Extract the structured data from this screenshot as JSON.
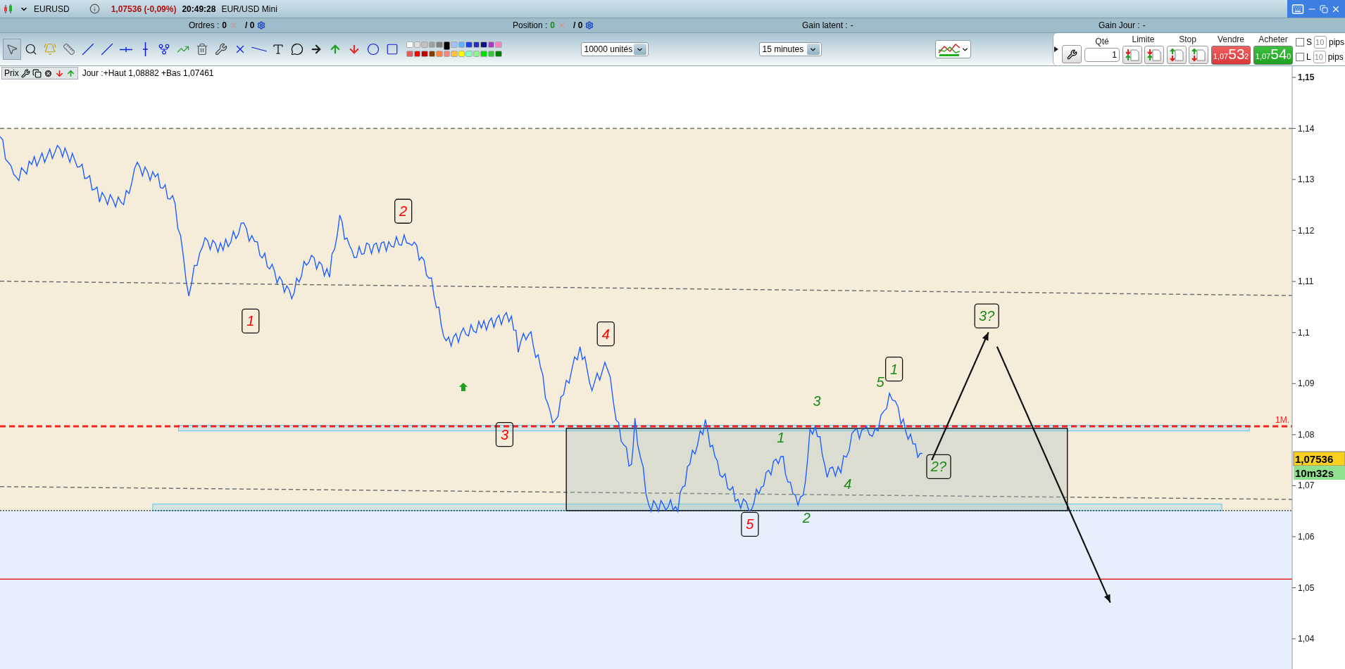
{
  "title_bar": {
    "symbol": "EURUSD",
    "quote": "1,07536 (-0,09%)",
    "time": "20:49:28",
    "instrument": "EUR/USD Mini"
  },
  "status_bar": [
    {
      "kind": "count",
      "label": "Ordres :",
      "value": "0",
      "color": "#000000",
      "total": "/ 0"
    },
    {
      "kind": "count",
      "label": "Position :",
      "value": "0",
      "color": "#1a8a1a",
      "total": "/ 0"
    },
    {
      "kind": "gain",
      "label": "Gain latent :",
      "value": "-"
    },
    {
      "kind": "gain",
      "label": "Gain Jour :",
      "value": "-"
    }
  ],
  "toolbar": {
    "tools": [
      {
        "kind": "pointer",
        "selected": true
      },
      {
        "kind": "zoom",
        "selected": false
      },
      {
        "kind": "alert",
        "selected": false
      },
      {
        "kind": "ruler",
        "selected": false
      },
      {
        "kind": "segment",
        "selected": false
      },
      {
        "kind": "line",
        "selected": false
      },
      {
        "kind": "hline",
        "selected": false
      },
      {
        "kind": "vline",
        "selected": false
      },
      {
        "kind": "pitchfork",
        "selected": false
      },
      {
        "kind": "fibonacci",
        "selected": false
      },
      {
        "kind": "trash",
        "selected": false
      },
      {
        "kind": "tools",
        "selected": false
      },
      {
        "kind": "cross",
        "selected": false
      },
      {
        "kind": "channel",
        "selected": false
      },
      {
        "kind": "text",
        "selected": false
      },
      {
        "kind": "bubble",
        "selected": false
      },
      {
        "kind": "arrow_right",
        "selected": false
      },
      {
        "kind": "arrow_up",
        "selected": false
      },
      {
        "kind": "arrow_down",
        "selected": false
      },
      {
        "kind": "ellipse",
        "selected": false
      },
      {
        "kind": "rectangle",
        "selected": false
      }
    ],
    "palette": [
      {
        "color": "#ffffff",
        "selected": false
      },
      {
        "color": "#e0e0e0",
        "selected": false
      },
      {
        "color": "#c0c0c0",
        "selected": false
      },
      {
        "color": "#a0a0a0",
        "selected": false
      },
      {
        "color": "#808080",
        "selected": false
      },
      {
        "color": "#000000",
        "selected": true
      },
      {
        "color": "#a0c0ff",
        "selected": false
      },
      {
        "color": "#60b0ff",
        "selected": false
      },
      {
        "color": "#2040e0",
        "selected": false
      },
      {
        "color": "#2030c0",
        "selected": false
      },
      {
        "color": "#101080",
        "selected": false
      },
      {
        "color": "#a040c0",
        "selected": false
      },
      {
        "color": "#ff80c0",
        "selected": false
      },
      {
        "color": "#e06060",
        "selected": false
      },
      {
        "color": "#ff0000",
        "selected": false
      },
      {
        "color": "#c00000",
        "selected": false
      },
      {
        "color": "#804000",
        "selected": false
      },
      {
        "color": "#ff8040",
        "selected": false
      },
      {
        "color": "#ff8080",
        "selected": false
      },
      {
        "color": "#ffc040",
        "selected": false
      },
      {
        "color": "#ffff00",
        "selected": false
      },
      {
        "color": "#80ffc0",
        "selected": false
      },
      {
        "color": "#80ff80",
        "selected": false
      },
      {
        "color": "#00e000",
        "selected": false
      },
      {
        "color": "#40c040",
        "selected": false
      },
      {
        "color": "#008000",
        "selected": false
      }
    ],
    "quantity_select": {
      "value": "10000 unités"
    },
    "period_select": {
      "value": "15 minutes"
    }
  },
  "order_panel": {
    "quantity_label": "Qté",
    "quantity": "1",
    "limit_label": "Limite",
    "stop_label": "Stop",
    "sell": {
      "label": "Vendre",
      "prefix": "1,07",
      "pips": "53",
      "fraction": "2"
    },
    "buy": {
      "label": "Acheter",
      "prefix": "1,07",
      "pips": "54",
      "fraction": "0"
    },
    "options": [
      {
        "label": "S",
        "checked": false,
        "placeholder": "10",
        "unit": "pips"
      },
      {
        "label": "L",
        "checked": false,
        "placeholder": "10",
        "unit": "pips"
      }
    ]
  },
  "chart_header": {
    "label": "Prix",
    "info": "Jour :+Haut 1,08882 +Bas 1,07461"
  },
  "chart": {
    "axis_labels": [
      "1,15",
      "1,14",
      "1,13",
      "1,12",
      "1,11",
      "1,1",
      "1,09",
      "1,08",
      "1,07",
      "1,06",
      "1,05",
      "1,04"
    ],
    "level_label": "1M.",
    "last_price": "1,07536",
    "countdown": "10m32s",
    "wave_labels": [
      {
        "text": "1",
        "color": "#ff0000",
        "boxed": true
      },
      {
        "text": "2",
        "color": "#ff0000",
        "boxed": true
      },
      {
        "text": "3",
        "color": "#ff0000",
        "boxed": true
      },
      {
        "text": "4",
        "color": "#ff0000",
        "boxed": true
      },
      {
        "text": "5",
        "color": "#ff0000",
        "boxed": true
      },
      {
        "text": "1",
        "color": "#1a8a1a",
        "boxed": false
      },
      {
        "text": "2",
        "color": "#1a8a1a",
        "boxed": false
      },
      {
        "text": "3",
        "color": "#1a8a1a",
        "boxed": false
      },
      {
        "text": "4",
        "color": "#1a8a1a",
        "boxed": false
      },
      {
        "text": "5",
        "color": "#1a8a1a",
        "boxed": false
      },
      {
        "text": "1",
        "color": "#1a8a1a",
        "boxed": true
      },
      {
        "text": "2?",
        "color": "#1a8a1a",
        "boxed": true
      },
      {
        "text": "3?",
        "color": "#1a8a1a",
        "boxed": true
      }
    ]
  }
}
